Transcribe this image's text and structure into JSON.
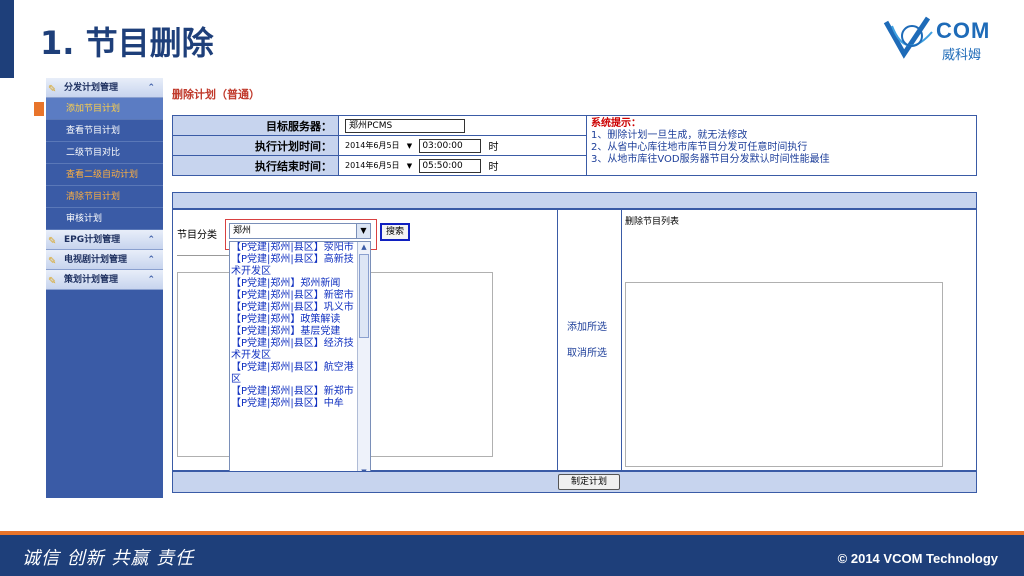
{
  "slide": {
    "title": "1. 节目删除",
    "logo_text": "COM",
    "logo_sub": "威科姆"
  },
  "sidebar": {
    "groups": [
      {
        "label": "分发计划管理",
        "arrow": "⌃"
      },
      {
        "label": "EPG计划管理",
        "arrow": "⌃"
      },
      {
        "label": "电视剧计划管理",
        "arrow": "⌃"
      },
      {
        "label": "策划计划管理",
        "arrow": "⌃"
      }
    ],
    "items": [
      {
        "label": "添加节目计划"
      },
      {
        "label": "查看节目计划"
      },
      {
        "label": "二级节目对比"
      },
      {
        "label": "查看二级自动计划"
      },
      {
        "label": "清除节目计划"
      },
      {
        "label": "审核计划"
      }
    ]
  },
  "main": {
    "title": "删除计划（普通）",
    "form": {
      "server_label": "目标服务器：",
      "server_value": "郑州PCMS",
      "start_label": "执行计划时间：",
      "start_date": "2014年6月5日",
      "start_time": "03:00:00",
      "end_label": "执行结束时间：",
      "end_date": "2014年6月5日",
      "end_time": "05:50:00",
      "unit": "时"
    },
    "tips": {
      "title": "系统提示：",
      "lines": [
        "1、删除计划一旦生成，就无法修改",
        "2、从省中心库往地市库节目分发可任意时间执行",
        "3、从地市库往VOD服务器节目分发默认时间性能最佳"
      ]
    },
    "category_label": "节目分类",
    "category_value": "郑州",
    "search_label": "搜索",
    "dropdown_items": [
      "【P党建|郑州|县区】荥阳市",
      "【P党建|郑州|县区】高新技术开发区",
      "【P党建|郑州】郑州新闻",
      "【P党建|郑州|县区】新密市",
      "【P党建|郑州|县区】巩义市",
      "【P党建|郑州】政策解读",
      "【P党建|郑州】基层党建",
      "【P党建|郑州|县区】经济技术开发区",
      "【P党建|郑州|县区】航空港区",
      "【P党建|郑州|县区】新郑市",
      "【P党建|郑州|县区】中牟"
    ],
    "add_selected": "添加所选",
    "cancel_selected": "取消所选",
    "target_list_label": "删除节目列表",
    "submit_label": "制定计划"
  },
  "footer": {
    "slogan": "诚信 创新 共赢  责任",
    "copyright": "© 2014 VCOM Technology"
  },
  "colors": {
    "brand_blue": "#1e3f7a",
    "accent_orange": "#e8742a",
    "sidebar_blue": "#3a5ba6"
  }
}
